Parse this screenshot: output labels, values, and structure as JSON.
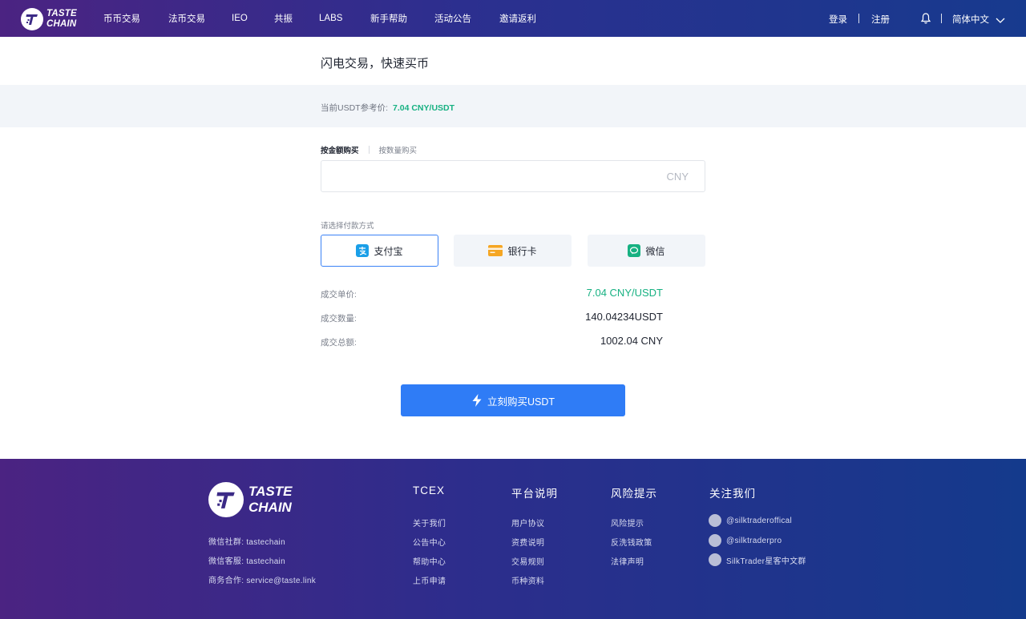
{
  "brand": {
    "line1": "TASTE",
    "line2": "CHAIN"
  },
  "nav": [
    {
      "label": "币币交易"
    },
    {
      "label": "法币交易"
    },
    {
      "label": "IEO"
    },
    {
      "label": "共振"
    },
    {
      "label": "LABS"
    },
    {
      "label": "新手帮助"
    },
    {
      "label": "活动公告"
    },
    {
      "label": "邀请返利"
    }
  ],
  "header_right": {
    "login": "登录",
    "register": "注册",
    "language": "简体中文"
  },
  "main": {
    "title": "闪电交易，快速买币",
    "price_label": "当前USDT参考价:",
    "price_value": "7.04 CNY/USDT",
    "tabs": {
      "by_amount": "按金额购买",
      "by_quantity": "按数量购买"
    },
    "amount_input": {
      "value": "",
      "unit": "CNY"
    },
    "pay_label": "请选择付款方式",
    "pay_methods": [
      {
        "label": "支付宝",
        "icon": "alipay-icon",
        "color": "#1a9fe8"
      },
      {
        "label": "银行卡",
        "icon": "bank-card-icon",
        "color": "#f5a623"
      },
      {
        "label": "微信",
        "icon": "wechat-icon",
        "color": "#17b182"
      }
    ],
    "summary": [
      {
        "label": "成交单价:",
        "value": "7.04 CNY/USDT"
      },
      {
        "label": "成交数量:",
        "value": "140.04234USDT"
      },
      {
        "label": "成交总额:",
        "value": "1002.04 CNY"
      }
    ],
    "buy_button": "立刻购买USDT"
  },
  "footer": {
    "brand": {
      "line1": "TASTE",
      "line2": "CHAIN"
    },
    "info": [
      "微信社群:  tastechain",
      "微信客服:  tastechain",
      "商务合作:  service@taste.link"
    ],
    "columns": [
      {
        "title": "TCEX",
        "links": [
          "关于我们",
          "公告中心",
          "帮助中心",
          "上币申请"
        ]
      },
      {
        "title": "平台说明",
        "links": [
          "用户协议",
          "资费说明",
          "交易规则",
          "币种资料"
        ]
      },
      {
        "title": "风险提示",
        "links": [
          "风险提示",
          "反洗钱政策",
          "法律声明"
        ]
      }
    ],
    "follow": {
      "title": "关注我们",
      "items": [
        "@silktraderoffical",
        "@silktraderpro",
        "SilkTrader星客中文群"
      ]
    }
  },
  "colors": {
    "accent": "#2f7cf6",
    "green": "#17b182",
    "header_start": "#4b2382",
    "header_end": "#173a8e"
  }
}
